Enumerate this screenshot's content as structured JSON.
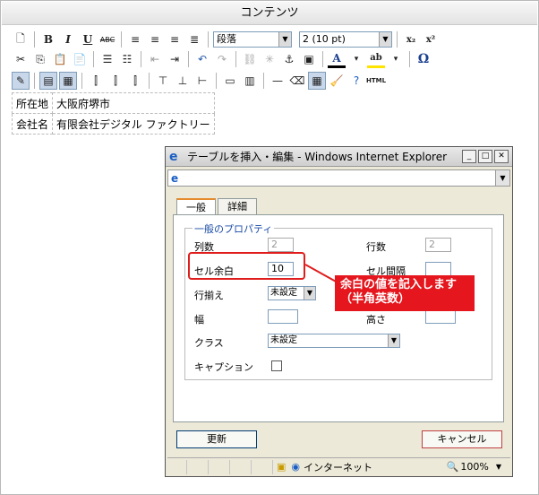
{
  "editor": {
    "title": "コンテンツ",
    "toolbar": {
      "format_select": "段落",
      "size_select": "2 (10 pt)",
      "row1_icons": [
        "new-document-icon",
        "bold-icon",
        "italic-icon",
        "underline-icon",
        "strikethrough-icon",
        "align-left-icon",
        "align-center-icon",
        "align-right-icon",
        "align-justify-icon",
        "subscript-icon",
        "superscript-icon"
      ],
      "row1_labels": {
        "bold": "B",
        "italic": "I",
        "underline": "U",
        "strike": "ABC",
        "sub": "x₂",
        "sup": "x²"
      },
      "row2_labels": {
        "omega": "Ω",
        "html": "HTML",
        "font_color": "A",
        "highlight": "ab"
      }
    },
    "table_rows": [
      [
        "所在地",
        "大阪府堺市"
      ],
      [
        "会社名",
        "有限会社デジタル ファクトリー"
      ]
    ]
  },
  "dialog": {
    "title": "テーブルを挿入・編集 - Windows Internet Explorer",
    "tabs": [
      "一般",
      "詳細"
    ],
    "group_label": "一般のプロパティ",
    "fields": {
      "columns_label": "列数",
      "columns_value": "2",
      "rows_label": "行数",
      "rows_value": "2",
      "cellpadding_label": "セル余白",
      "cellpadding_value": "10",
      "cellspacing_label": "セル間隔",
      "cellspacing_value": "",
      "align_label": "行揃え",
      "align_value": "未設定",
      "width_label": "幅",
      "width_value": "",
      "height_label": "高さ",
      "height_value": "",
      "class_label": "クラス",
      "class_value": "未設定",
      "caption_label": "キャプション"
    },
    "update_button": "更新",
    "cancel_button": "キャンセル",
    "status": {
      "zone": "インターネット",
      "zoom": "100%"
    }
  },
  "callout": {
    "line1": "余白の値を記入します",
    "line2": "（半角英数）"
  },
  "colors": {
    "accent_red": "#e5161d",
    "tab_orange": "#e68b2c"
  }
}
